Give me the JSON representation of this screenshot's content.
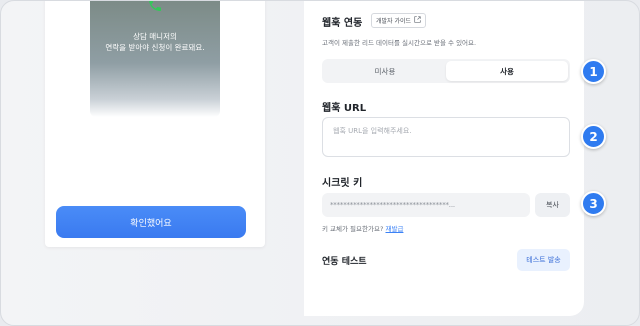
{
  "left_preview": {
    "phone_message_line1": "상담 매니저의",
    "phone_message_line2": "연락을 받아야 신청이 완료돼요.",
    "call_icon": "phone-icon",
    "confirm_button": "확인했어요"
  },
  "webhook": {
    "title": "웹훅 연동",
    "dev_guide_label": "개발자 가이드",
    "dev_guide_icon": "external-link-icon",
    "description": "고객이 제출한 리드 데이터를 실시간으로 받을 수 있어요.",
    "toggle": {
      "options": [
        "미사용",
        "사용"
      ],
      "selected": "사용"
    }
  },
  "url_section": {
    "label": "웹훅 URL",
    "placeholder": "웹훅 URL을 입력해주세요."
  },
  "secret_section": {
    "label": "시크릿 키",
    "masked_value": "************************************...",
    "copy_button": "복사",
    "reissue_hint": "키 교체가 필요한가요?",
    "reissue_link": "재발급"
  },
  "test_section": {
    "label": "연동 테스트",
    "button": "테스트 발송"
  },
  "callouts": [
    "1",
    "2",
    "3"
  ],
  "colors": {
    "accent": "#3b82f6",
    "badge": "#2f7bf0",
    "call_green": "#34c759"
  }
}
